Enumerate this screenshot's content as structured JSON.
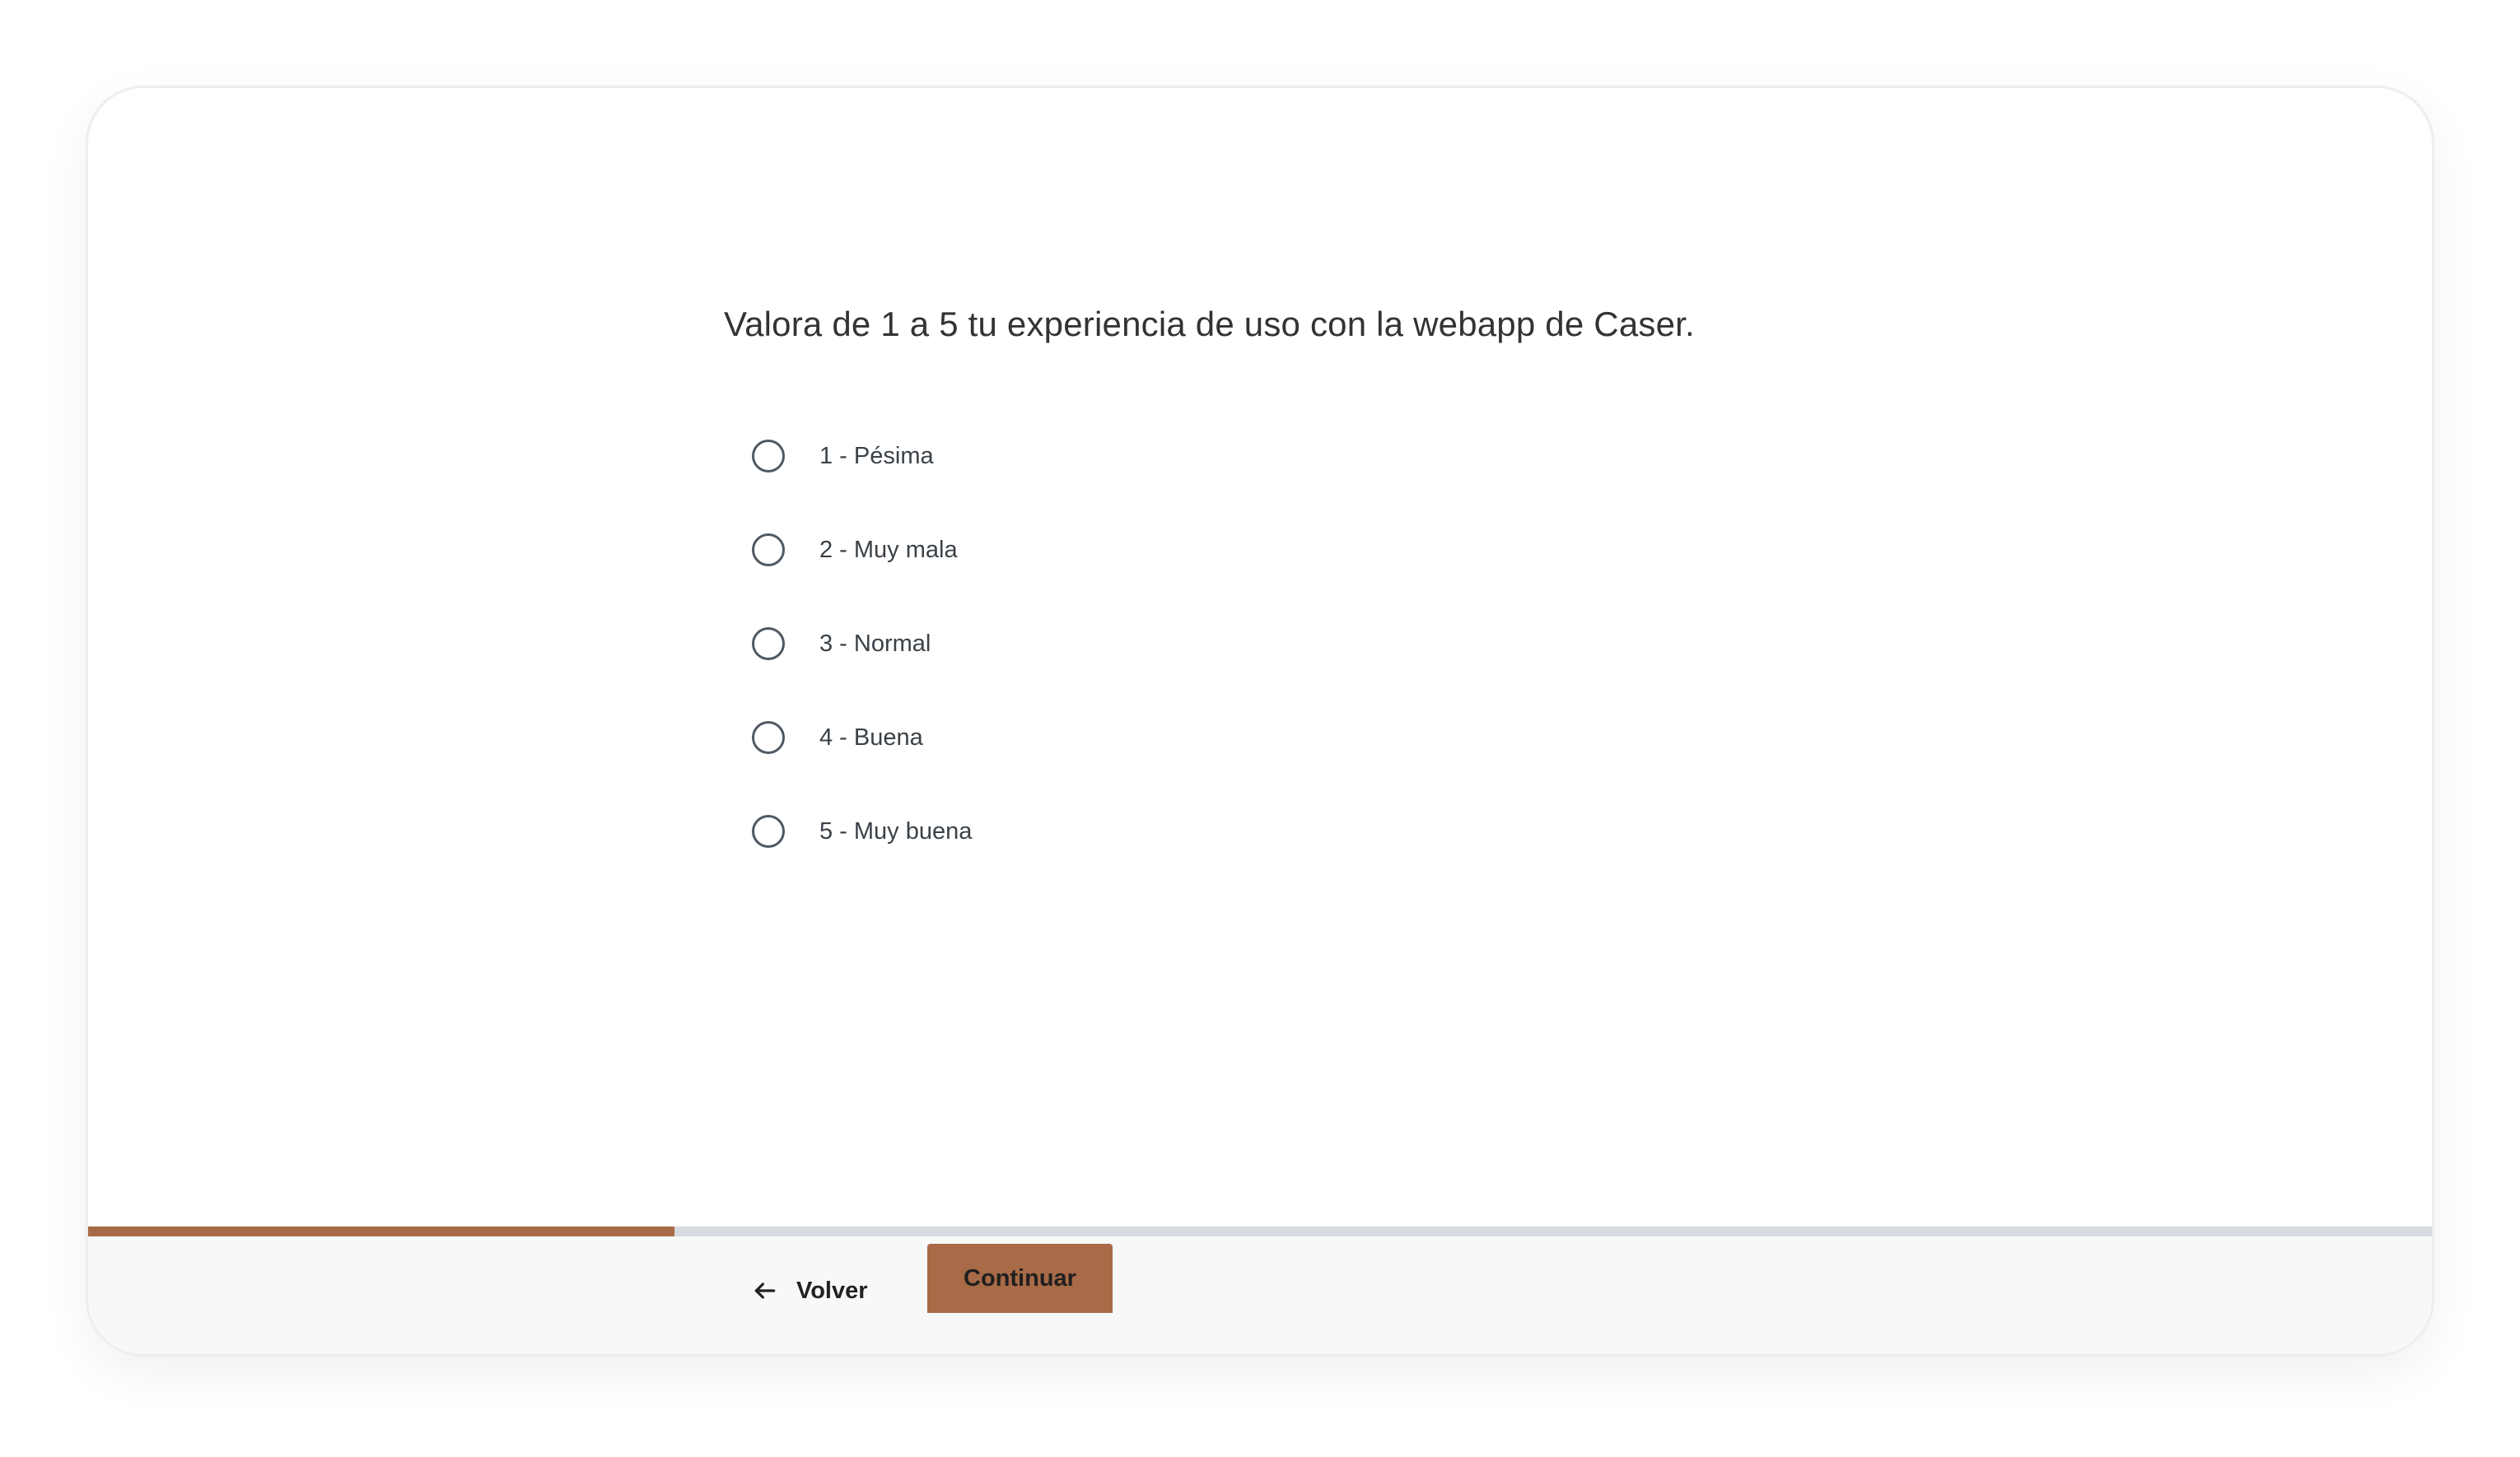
{
  "survey": {
    "question": "Valora de 1 a 5 tu experiencia de uso con la webapp de Caser.",
    "options": [
      {
        "label": "1 - Pésima",
        "selected": false
      },
      {
        "label": "2 - Muy mala",
        "selected": false
      },
      {
        "label": "3 - Normal",
        "selected": false
      },
      {
        "label": "4 - Buena",
        "selected": false
      },
      {
        "label": "5 - Muy buena",
        "selected": false
      }
    ]
  },
  "footer": {
    "progress_fraction": 0.25,
    "back_label": "Volver",
    "back_icon": "arrow-left-icon",
    "continue_label": "Continuar"
  },
  "colors": {
    "accent": "#a86a47",
    "progress_track": "#d5dbde",
    "footer_background": "#f7f8f8"
  }
}
